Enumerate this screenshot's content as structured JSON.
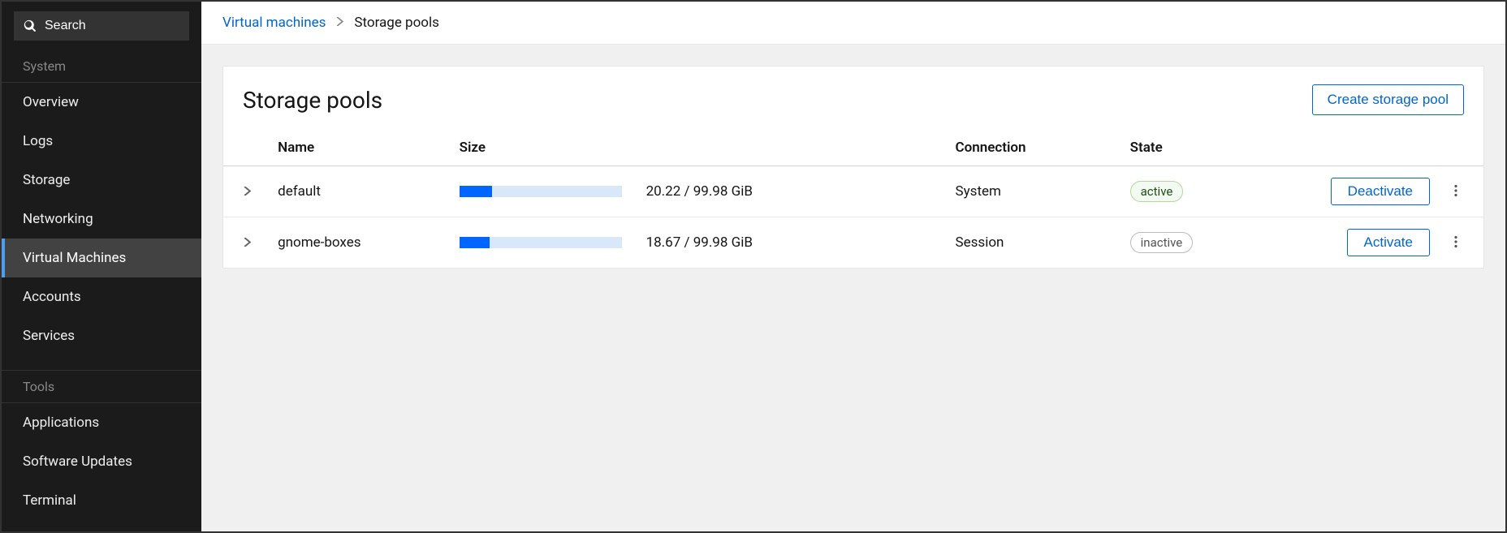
{
  "search": {
    "placeholder": "Search"
  },
  "sidebar": {
    "section_system": "System",
    "section_tools": "Tools",
    "items_system": [
      {
        "label": "Overview"
      },
      {
        "label": "Logs"
      },
      {
        "label": "Storage"
      },
      {
        "label": "Networking"
      },
      {
        "label": "Virtual Machines"
      },
      {
        "label": "Accounts"
      },
      {
        "label": "Services"
      }
    ],
    "items_tools": [
      {
        "label": "Applications"
      },
      {
        "label": "Software Updates"
      },
      {
        "label": "Terminal"
      }
    ]
  },
  "breadcrumb": {
    "parent": "Virtual machines",
    "current": "Storage pools"
  },
  "page": {
    "title": "Storage pools",
    "create_label": "Create storage pool"
  },
  "table": {
    "headers": {
      "name": "Name",
      "size": "Size",
      "connection": "Connection",
      "state": "State"
    },
    "rows": [
      {
        "name": "default",
        "used": 20.22,
        "total": 99.98,
        "unit": "GiB",
        "size_text": "20.22 / 99.98 GiB",
        "connection": "System",
        "state": "active",
        "action_label": "Deactivate"
      },
      {
        "name": "gnome-boxes",
        "used": 18.67,
        "total": 99.98,
        "unit": "GiB",
        "size_text": "18.67 / 99.98 GiB",
        "connection": "Session",
        "state": "inactive",
        "action_label": "Activate"
      }
    ]
  }
}
